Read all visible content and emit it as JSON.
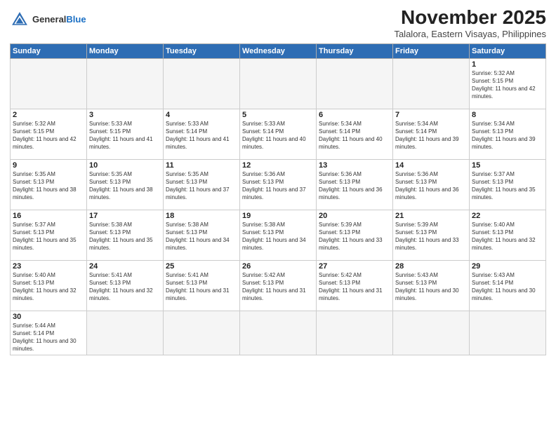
{
  "logo": {
    "line1": "General",
    "line2": "Blue"
  },
  "title": "November 2025",
  "location": "Talalora, Eastern Visayas, Philippines",
  "days_of_week": [
    "Sunday",
    "Monday",
    "Tuesday",
    "Wednesday",
    "Thursday",
    "Friday",
    "Saturday"
  ],
  "weeks": [
    [
      {
        "day": "",
        "empty": true
      },
      {
        "day": "",
        "empty": true
      },
      {
        "day": "",
        "empty": true
      },
      {
        "day": "",
        "empty": true
      },
      {
        "day": "",
        "empty": true
      },
      {
        "day": "",
        "empty": true
      },
      {
        "day": "1",
        "sunrise": "5:32 AM",
        "sunset": "5:15 PM",
        "daylight": "11 hours and 42 minutes."
      }
    ],
    [
      {
        "day": "2",
        "sunrise": "5:32 AM",
        "sunset": "5:15 PM",
        "daylight": "11 hours and 42 minutes."
      },
      {
        "day": "3",
        "sunrise": "5:33 AM",
        "sunset": "5:15 PM",
        "daylight": "11 hours and 41 minutes."
      },
      {
        "day": "4",
        "sunrise": "5:33 AM",
        "sunset": "5:14 PM",
        "daylight": "11 hours and 41 minutes."
      },
      {
        "day": "5",
        "sunrise": "5:33 AM",
        "sunset": "5:14 PM",
        "daylight": "11 hours and 40 minutes."
      },
      {
        "day": "6",
        "sunrise": "5:34 AM",
        "sunset": "5:14 PM",
        "daylight": "11 hours and 40 minutes."
      },
      {
        "day": "7",
        "sunrise": "5:34 AM",
        "sunset": "5:14 PM",
        "daylight": "11 hours and 39 minutes."
      },
      {
        "day": "8",
        "sunrise": "5:34 AM",
        "sunset": "5:13 PM",
        "daylight": "11 hours and 39 minutes."
      }
    ],
    [
      {
        "day": "9",
        "sunrise": "5:35 AM",
        "sunset": "5:13 PM",
        "daylight": "11 hours and 38 minutes."
      },
      {
        "day": "10",
        "sunrise": "5:35 AM",
        "sunset": "5:13 PM",
        "daylight": "11 hours and 38 minutes."
      },
      {
        "day": "11",
        "sunrise": "5:35 AM",
        "sunset": "5:13 PM",
        "daylight": "11 hours and 37 minutes."
      },
      {
        "day": "12",
        "sunrise": "5:36 AM",
        "sunset": "5:13 PM",
        "daylight": "11 hours and 37 minutes."
      },
      {
        "day": "13",
        "sunrise": "5:36 AM",
        "sunset": "5:13 PM",
        "daylight": "11 hours and 36 minutes."
      },
      {
        "day": "14",
        "sunrise": "5:36 AM",
        "sunset": "5:13 PM",
        "daylight": "11 hours and 36 minutes."
      },
      {
        "day": "15",
        "sunrise": "5:37 AM",
        "sunset": "5:13 PM",
        "daylight": "11 hours and 35 minutes."
      }
    ],
    [
      {
        "day": "16",
        "sunrise": "5:37 AM",
        "sunset": "5:13 PM",
        "daylight": "11 hours and 35 minutes."
      },
      {
        "day": "17",
        "sunrise": "5:38 AM",
        "sunset": "5:13 PM",
        "daylight": "11 hours and 35 minutes."
      },
      {
        "day": "18",
        "sunrise": "5:38 AM",
        "sunset": "5:13 PM",
        "daylight": "11 hours and 34 minutes."
      },
      {
        "day": "19",
        "sunrise": "5:38 AM",
        "sunset": "5:13 PM",
        "daylight": "11 hours and 34 minutes."
      },
      {
        "day": "20",
        "sunrise": "5:39 AM",
        "sunset": "5:13 PM",
        "daylight": "11 hours and 33 minutes."
      },
      {
        "day": "21",
        "sunrise": "5:39 AM",
        "sunset": "5:13 PM",
        "daylight": "11 hours and 33 minutes."
      },
      {
        "day": "22",
        "sunrise": "5:40 AM",
        "sunset": "5:13 PM",
        "daylight": "11 hours and 32 minutes."
      }
    ],
    [
      {
        "day": "23",
        "sunrise": "5:40 AM",
        "sunset": "5:13 PM",
        "daylight": "11 hours and 32 minutes."
      },
      {
        "day": "24",
        "sunrise": "5:41 AM",
        "sunset": "5:13 PM",
        "daylight": "11 hours and 32 minutes."
      },
      {
        "day": "25",
        "sunrise": "5:41 AM",
        "sunset": "5:13 PM",
        "daylight": "11 hours and 31 minutes."
      },
      {
        "day": "26",
        "sunrise": "5:42 AM",
        "sunset": "5:13 PM",
        "daylight": "11 hours and 31 minutes."
      },
      {
        "day": "27",
        "sunrise": "5:42 AM",
        "sunset": "5:13 PM",
        "daylight": "11 hours and 31 minutes."
      },
      {
        "day": "28",
        "sunrise": "5:43 AM",
        "sunset": "5:13 PM",
        "daylight": "11 hours and 30 minutes."
      },
      {
        "day": "29",
        "sunrise": "5:43 AM",
        "sunset": "5:14 PM",
        "daylight": "11 hours and 30 minutes."
      }
    ],
    [
      {
        "day": "30",
        "sunrise": "5:44 AM",
        "sunset": "5:14 PM",
        "daylight": "11 hours and 30 minutes."
      },
      {
        "day": "",
        "empty": true
      },
      {
        "day": "",
        "empty": true
      },
      {
        "day": "",
        "empty": true
      },
      {
        "day": "",
        "empty": true
      },
      {
        "day": "",
        "empty": true
      },
      {
        "day": "",
        "empty": true
      }
    ]
  ]
}
